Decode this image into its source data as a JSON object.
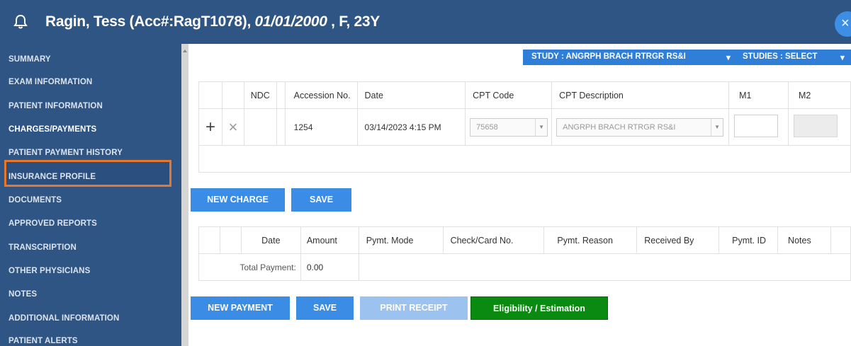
{
  "header": {
    "patient_name": "Ragin, Tess (Acc#:RagT1078), ",
    "dob": "01/01/2000",
    "sex_age": " , F, 23Y",
    "close_glyph": "×"
  },
  "sidebar": {
    "items": [
      {
        "label": "SUMMARY"
      },
      {
        "label": "EXAM INFORMATION"
      },
      {
        "label": "PATIENT INFORMATION"
      },
      {
        "label": "CHARGES/PAYMENTS"
      },
      {
        "label": "PATIENT PAYMENT HISTORY"
      },
      {
        "label": "INSURANCE PROFILE"
      },
      {
        "label": "DOCUMENTS"
      },
      {
        "label": "APPROVED REPORTS"
      },
      {
        "label": "TRANSCRIPTION"
      },
      {
        "label": "OTHER PHYSICIANS"
      },
      {
        "label": "NOTES"
      },
      {
        "label": "ADDITIONAL INFORMATION"
      },
      {
        "label": "PATIENT ALERTS"
      }
    ],
    "active_item": "CHARGES/PAYMENTS"
  },
  "study_bar": {
    "study": "STUDY : ANGRPH BRACH RTRGR RS&I",
    "studies": "STUDIES : SELECT"
  },
  "charges": {
    "columns": [
      "NDC",
      "Accession No.",
      "Date",
      "CPT Code",
      "CPT Description",
      "M1",
      "M2"
    ],
    "row": {
      "add_glyph": "+",
      "remove_glyph": "×",
      "ndc": "",
      "accession": "1254",
      "date": "03/14/2023 4:15 PM",
      "cpt_code": "75658",
      "cpt_description": "ANGRPH BRACH RTRGR RS&I"
    }
  },
  "charge_buttons": {
    "new_charge": "NEW CHARGE",
    "save": "SAVE"
  },
  "payments": {
    "columns": [
      "Date",
      "Amount",
      "Pymt. Mode",
      "Check/Card No.",
      "Pymt. Reason",
      "Received By",
      "Pymt. ID",
      "Notes"
    ],
    "total_label": "Total Payment:",
    "total_value": "0.00"
  },
  "payment_buttons": {
    "new_payment": "NEW PAYMENT",
    "save": "SAVE",
    "print_receipt": "PRINT RECEIPT",
    "eligibility": "Eligibility / Estimation"
  },
  "colors": {
    "header_bg": "#2e5584",
    "active_border": "#e5782d",
    "button_blue": "#3b8ce4",
    "button_green": "#0b8a12"
  }
}
